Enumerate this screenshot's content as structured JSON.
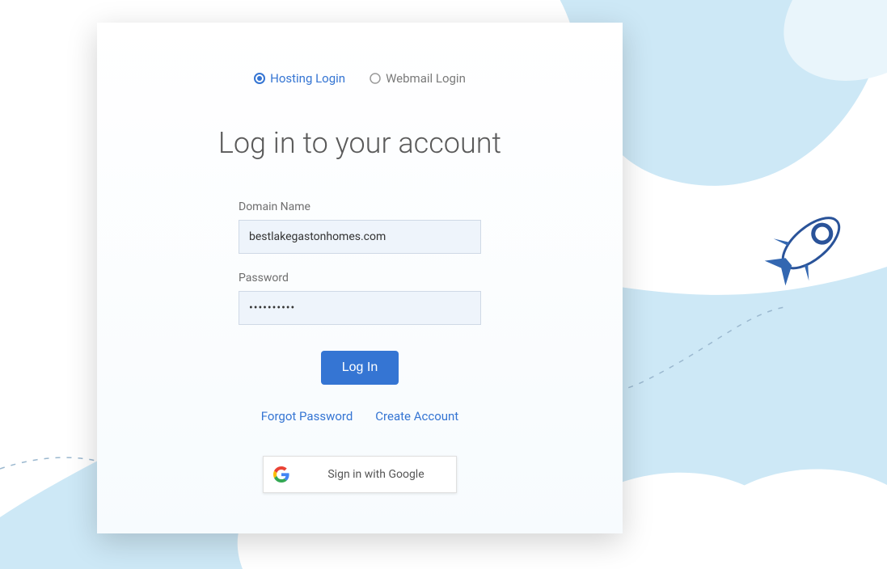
{
  "tabs": {
    "hosting": "Hosting Login",
    "webmail": "Webmail Login",
    "selected": "hosting"
  },
  "title": "Log in to your account",
  "form": {
    "domain_label": "Domain Name",
    "domain_value": "bestlakegastonhomes.com",
    "password_label": "Password",
    "password_value": "••••••••••",
    "submit_label": "Log In"
  },
  "links": {
    "forgot": "Forgot Password",
    "create": "Create Account"
  },
  "google_signin": "Sign in with Google"
}
